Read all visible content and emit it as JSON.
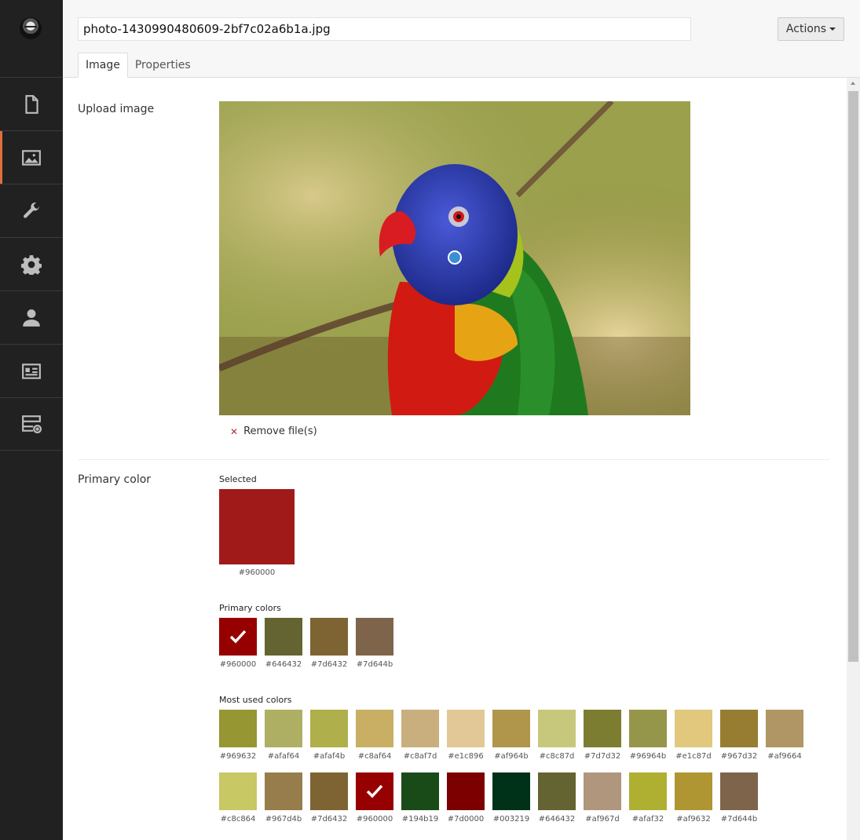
{
  "header": {
    "filename": "photo-1430990480609-2bf7c02a6b1a.jpg",
    "actions_label": "Actions"
  },
  "tabs": [
    {
      "label": "Image",
      "active": true
    },
    {
      "label": "Properties",
      "active": false
    }
  ],
  "sidebar": {
    "items": [
      {
        "icon": "document-icon",
        "active": false
      },
      {
        "icon": "image-icon",
        "active": true
      },
      {
        "icon": "wrench-icon",
        "active": false
      },
      {
        "icon": "gear-icon",
        "active": false
      },
      {
        "icon": "user-icon",
        "active": false
      },
      {
        "icon": "id-card-icon",
        "active": false
      },
      {
        "icon": "server-add-icon",
        "active": false
      }
    ],
    "accent_color": "#e0703a"
  },
  "upload": {
    "label": "Upload image",
    "remove_label": "Remove file(s)"
  },
  "primary_color": {
    "label": "Primary color",
    "selected_title": "Selected",
    "selected_hex": "#960000",
    "selected_swatch_color": "#a01a1a",
    "primary_title": "Primary colors",
    "primary_colors": [
      {
        "hex": "#960000",
        "checked": true
      },
      {
        "hex": "#646432",
        "checked": false
      },
      {
        "hex": "#7d6432",
        "checked": false
      },
      {
        "hex": "#7d644b",
        "checked": false
      }
    ],
    "most_used_title": "Most used colors",
    "most_used_row1": [
      {
        "hex": "#969632",
        "checked": false
      },
      {
        "hex": "#afaf64",
        "checked": false
      },
      {
        "hex": "#afaf4b",
        "checked": false
      },
      {
        "hex": "#c8af64",
        "checked": false
      },
      {
        "hex": "#c8af7d",
        "checked": false
      },
      {
        "hex": "#e1c896",
        "checked": false
      },
      {
        "hex": "#af964b",
        "checked": false
      },
      {
        "hex": "#c8c87d",
        "checked": false
      },
      {
        "hex": "#7d7d32",
        "checked": false
      },
      {
        "hex": "#96964b",
        "checked": false
      },
      {
        "hex": "#e1c87d",
        "checked": false
      },
      {
        "hex": "#967d32",
        "checked": false
      },
      {
        "hex": "#af9664",
        "checked": false
      }
    ],
    "most_used_row2": [
      {
        "hex": "#c8c864",
        "checked": false
      },
      {
        "hex": "#967d4b",
        "checked": false
      },
      {
        "hex": "#7d6432",
        "checked": false
      },
      {
        "hex": "#960000",
        "checked": true
      },
      {
        "hex": "#194b19",
        "checked": false
      },
      {
        "hex": "#7d0000",
        "checked": false
      },
      {
        "hex": "#003219",
        "checked": false
      },
      {
        "hex": "#646432",
        "checked": false
      },
      {
        "hex": "#af967d",
        "checked": false
      },
      {
        "hex": "#afaf32",
        "checked": false
      },
      {
        "hex": "#af9632",
        "checked": false
      },
      {
        "hex": "#7d644b",
        "checked": false
      }
    ]
  }
}
